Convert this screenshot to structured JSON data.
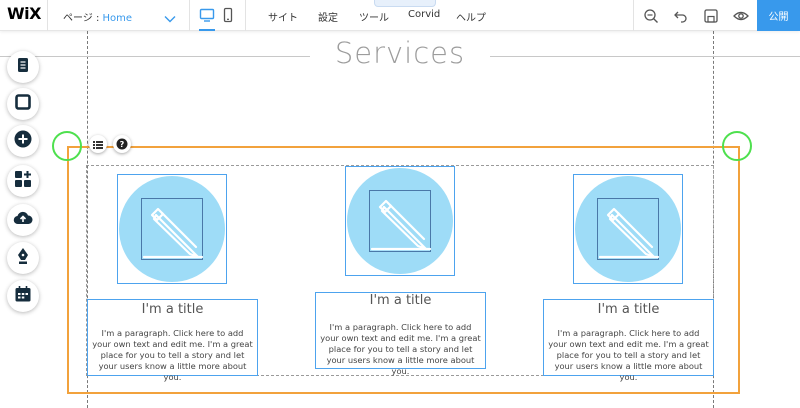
{
  "app": {
    "logo": "WiX"
  },
  "toolbar": {
    "page_label": "ページ : ",
    "page_name": "Home",
    "menu": [
      "サイト",
      "設定",
      "ツール",
      "Corvid",
      "ヘルプ"
    ],
    "publish_label": "公開"
  },
  "canvas": {
    "section_title": "Services",
    "cards": [
      {
        "title": "I'm a title",
        "paragraph": "I'm a paragraph. Click here to add your own text and edit me. I'm a great place for you to tell a story and let your users know a little more about you."
      },
      {
        "title": "I'm a title",
        "paragraph": "I'm a paragraph. Click here to add your own text and edit me. I'm a great place for you to tell a story and let your users know a little more about you."
      },
      {
        "title": "I'm a title",
        "paragraph": "I'm a paragraph. Click here to add your own text and edit me. I'm a great place for you to tell a story and let your users know a little more about you."
      }
    ]
  },
  "left_tools": [
    "pages-icon",
    "background-icon",
    "add-icon",
    "app-market-icon",
    "upload-icon",
    "blog-pen-icon",
    "bookings-calendar-icon"
  ],
  "colors": {
    "accent": "#3899ec",
    "selection": "#f2a23c",
    "handle": "#4ee04e",
    "image_circle": "#9edcf7"
  }
}
